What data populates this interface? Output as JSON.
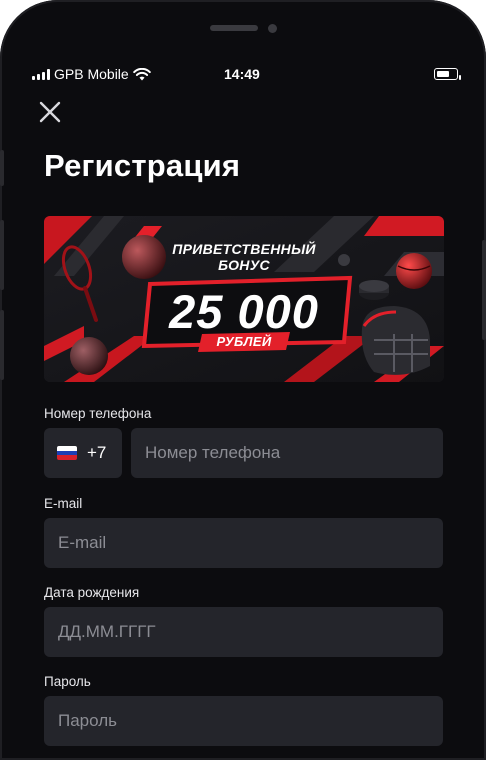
{
  "status_bar": {
    "carrier": "GPB Mobile",
    "time": "14:49"
  },
  "header": {
    "title": "Регистрация"
  },
  "banner": {
    "line1": "ПРИВЕТСТВЕННЫЙ",
    "line2": "БОНУС",
    "amount": "25 000",
    "currency": "РУБЛЕЙ"
  },
  "form": {
    "phone": {
      "label": "Номер телефона",
      "country_code": "+7",
      "placeholder": "Номер телефона"
    },
    "email": {
      "label": "E-mail",
      "placeholder": "E-mail"
    },
    "birthdate": {
      "label": "Дата рождения",
      "placeholder": "ДД.ММ.ГГГГ"
    },
    "password": {
      "label": "Пароль",
      "placeholder": "Пароль"
    }
  },
  "colors": {
    "background": "#141418",
    "input_bg": "#24252b",
    "accent_red": "#e3202a"
  }
}
